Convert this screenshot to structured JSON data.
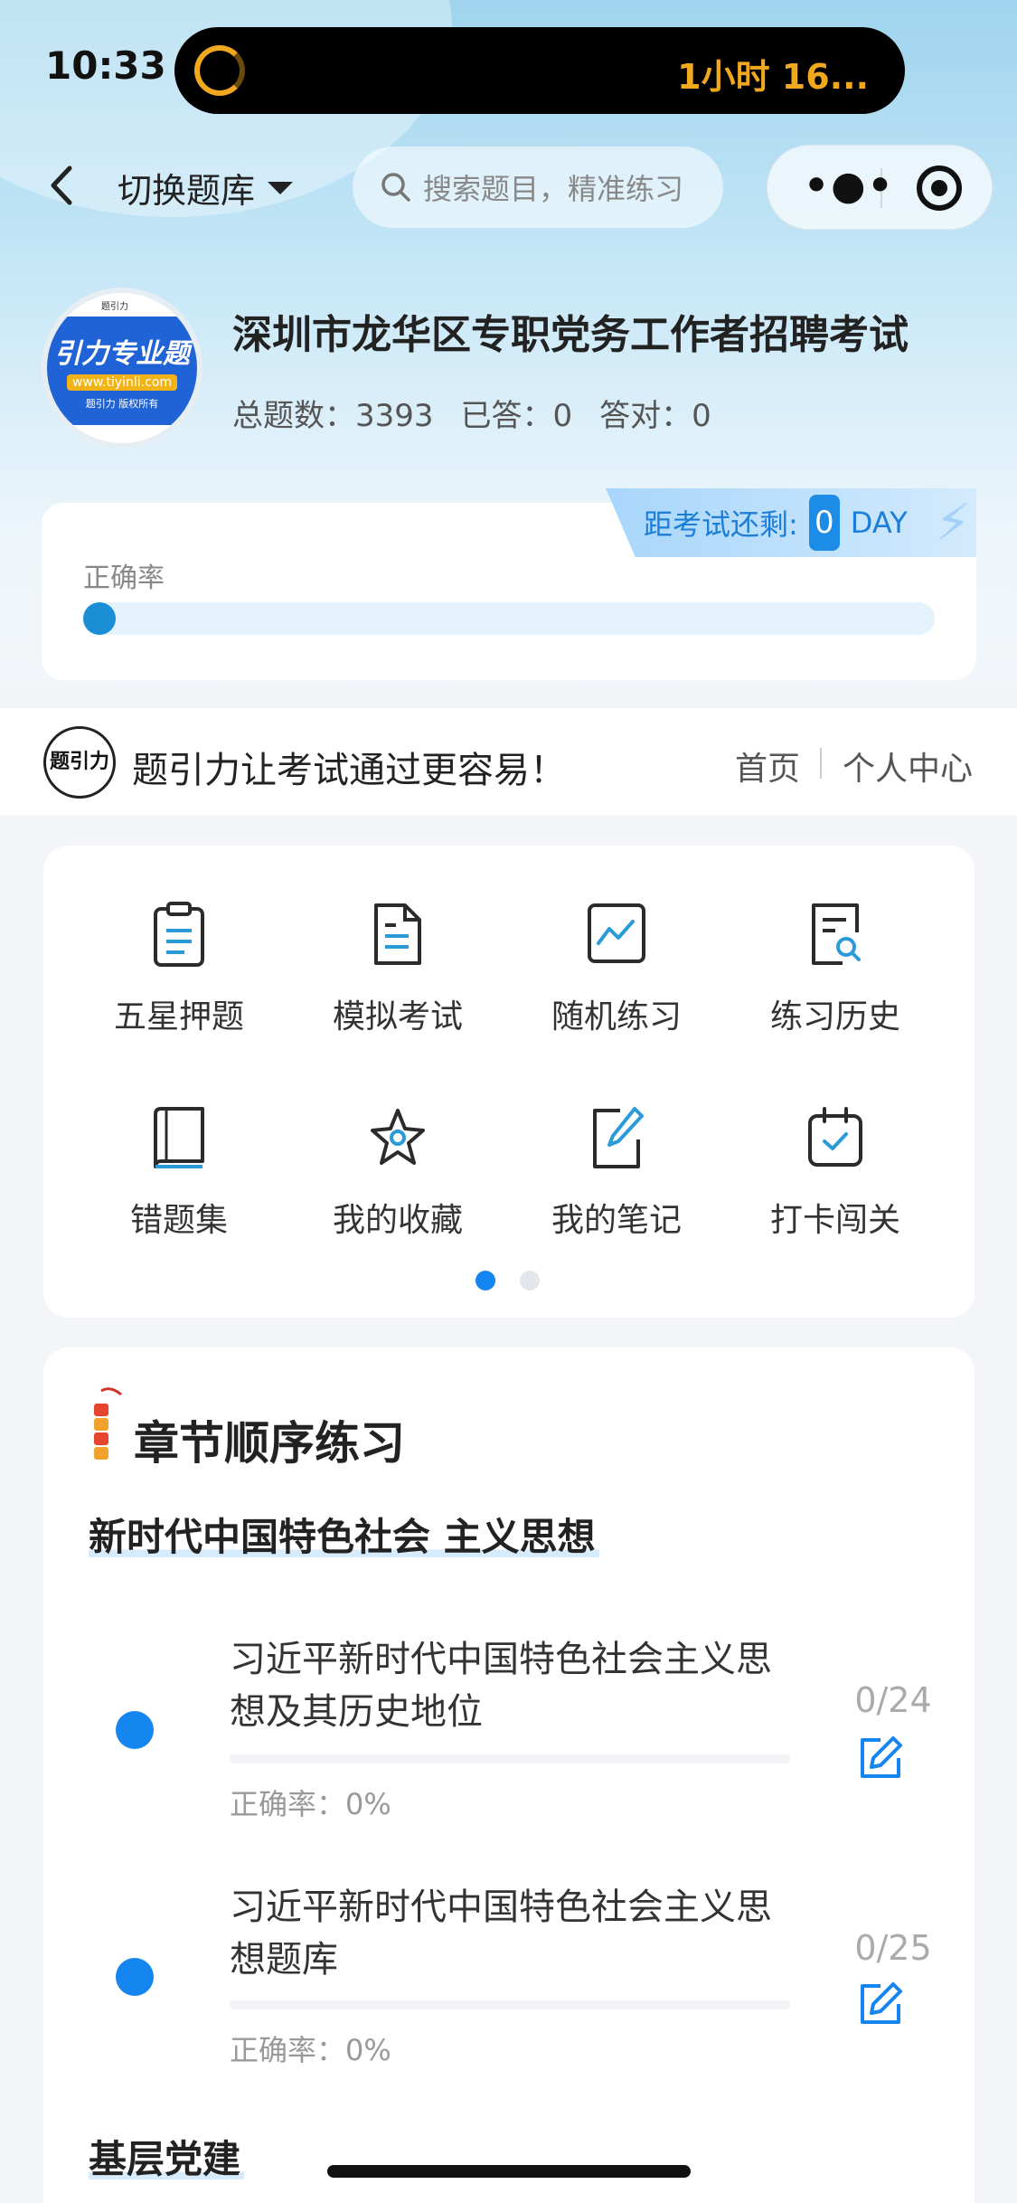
{
  "status": {
    "time": "10:33",
    "activity": "1小时 16..."
  },
  "nav": {
    "switch_label": "切换题库",
    "search_placeholder": "搜索题目，精准练习"
  },
  "exam": {
    "title": "深圳市龙华区专职党务工作者招聘考试",
    "total_label": "总题数：",
    "total": "3393",
    "answered_label": "已答：",
    "answered": "0",
    "correct_label": "答对：",
    "correct": "0",
    "logo_title": "引力专业题",
    "logo_url": "www.tiyinli.com",
    "logo_copy": "题引力 版权所有",
    "logo_badge": "题引力"
  },
  "countdown": {
    "label": "距考试还剩:",
    "days": "0",
    "unit": "DAY"
  },
  "accuracy": {
    "label": "正确率",
    "value_percent": 0
  },
  "slogan": {
    "logo_text": "题引力",
    "text": "题引力让考试通过更容易！",
    "home": "首页",
    "user_center": "个人中心"
  },
  "grid": [
    {
      "label": "五星押题",
      "icon": "clipboard-icon"
    },
    {
      "label": "模拟考试",
      "icon": "document-icon"
    },
    {
      "label": "随机练习",
      "icon": "chart-icon"
    },
    {
      "label": "练习历史",
      "icon": "history-search-icon"
    },
    {
      "label": "错题集",
      "icon": "book-icon"
    },
    {
      "label": "我的收藏",
      "icon": "star-icon"
    },
    {
      "label": "我的笔记",
      "icon": "note-edit-icon"
    },
    {
      "label": "打卡闯关",
      "icon": "calendar-check-icon"
    }
  ],
  "pager": {
    "pages": 2,
    "active": 0
  },
  "chapters": {
    "title": "章节顺序练习",
    "sections": [
      {
        "title": "新时代中国特色社会 主义思想",
        "items": [
          {
            "name": "习近平新时代中国特色社会主义思想及其历史地位",
            "accuracy": "正确率：0%",
            "count": "0/24"
          },
          {
            "name": "习近平新时代中国特色社会主义思想题库",
            "accuracy": "正确率：0%",
            "count": "0/25"
          }
        ]
      },
      {
        "title": "基层党建",
        "items": []
      }
    ]
  },
  "colors": {
    "accent": "#1585ef",
    "countdown_bg": "#a8d6fb",
    "activity": "#f0a81f"
  }
}
